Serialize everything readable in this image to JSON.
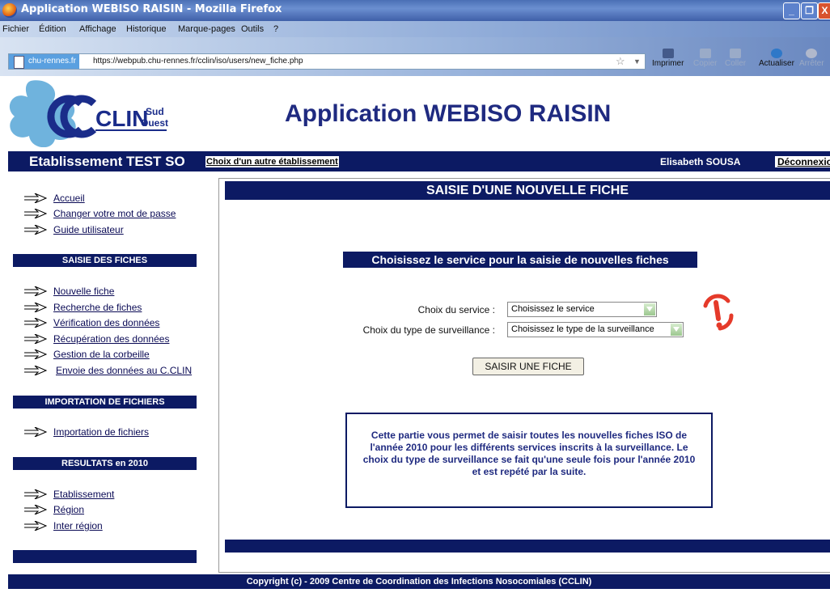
{
  "window": {
    "title": "Application WEBISO RAISIN - Mozilla Firefox",
    "min": "_",
    "max": "❐",
    "close": "X"
  },
  "menu": [
    "Fichier",
    "Édition",
    "Affichage",
    "Historique",
    "Marque-pages",
    "Outils",
    "?"
  ],
  "nav": {
    "site": "chu-rennes.fr",
    "url": "https://webpub.chu-rennes.fr/cclin/iso/users/new_fiche.php",
    "tools": [
      "Imprimer",
      "Copier",
      "Coller",
      "Actualiser",
      "Arrêter"
    ]
  },
  "header": {
    "logo_main": "CLIN",
    "logo_sud": "Sud",
    "logo_ouest": "Ouest",
    "app_title": "Application WEBISO RAISIN"
  },
  "estbar": {
    "establishment": "Etablissement TEST SO",
    "choose_other": "Choix d'un autre établissement",
    "user": "Elisabeth  SOUSA",
    "logout": "Déconnexion"
  },
  "sidebar": {
    "top_links": [
      "Accueil",
      "Changer votre mot de passe",
      "Guide utilisateur"
    ],
    "section1": "SAISIE DES FICHES",
    "section1_links": [
      "Nouvelle fiche",
      "Recherche de fiches",
      "Vérification des données",
      "Récupération des données",
      "Gestion de la corbeille",
      "Envoie des données au C.CLIN"
    ],
    "section2": "IMPORTATION DE FICHIERS",
    "section2_links": [
      "Importation de fichiers"
    ],
    "section3": "RESULTATS en 2010",
    "section3_links": [
      "Etablissement",
      "Région",
      "Inter région"
    ]
  },
  "main": {
    "heading": "SAISIE D'UNE NOUVELLE FICHE",
    "subheading": "Choisissez le service pour la saisie de nouvelles fiches",
    "service_label": "Choix du service :",
    "service_value": "Choisissez le service",
    "type_label": "Choix du type de surveillance :",
    "type_value": "Choisissez le type de la surveillance",
    "submit": "SAISIR UNE FICHE",
    "info": "Cette partie vous permet de saisir toutes les nouvelles fiches ISO de l'année 2010 pour les différents services inscrits à la surveillance. Le choix du type de surveillance se fait qu'une seule fois pour l'année 2010 et est repété par la suite."
  },
  "footer": "Copyright (c) - 2009 Centre de Coordination des Infections Nosocomiales (CCLIN)",
  "colors": {
    "navy": "#0c1a63",
    "title_blue": "#1f2a80",
    "logo_cyan": "#5aa8d8"
  },
  "icons": [
    "firefox-icon",
    "page-icon",
    "star-icon",
    "print-icon",
    "copy-icon",
    "paste-icon",
    "reload-icon",
    "stop-icon",
    "arrow-icon",
    "alert-icon"
  ]
}
